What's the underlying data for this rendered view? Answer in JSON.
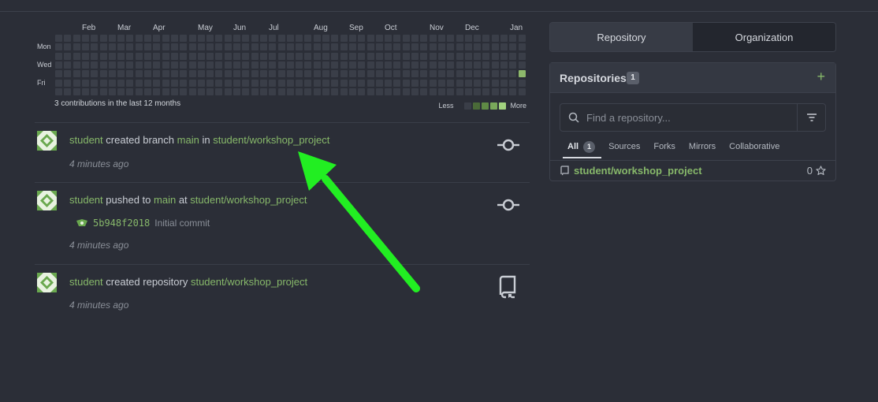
{
  "heatmap": {
    "months": [
      "Feb",
      "Mar",
      "Apr",
      "May",
      "Jun",
      "Jul",
      "Aug",
      "Sep",
      "Oct",
      "Nov",
      "Dec",
      "Jan"
    ],
    "days": [
      "Mon",
      "Wed",
      "Fri"
    ],
    "summary": "3 contributions in the last 12 months",
    "legend_less": "Less",
    "legend_more": "More",
    "level_colors": [
      "#3a3e48",
      "#4a6a38",
      "#5f8a45",
      "#79a85a",
      "#a2d27f"
    ],
    "active_color": "#8db86b"
  },
  "feed": [
    {
      "actor": "student",
      "action_a": "created branch",
      "ref": "main",
      "prep": "in",
      "repo": "student/workshop_project",
      "time": "4 minutes ago",
      "icon": "git-commit-icon"
    },
    {
      "actor": "student",
      "action_a": "pushed to",
      "ref": "main",
      "prep": "at",
      "repo": "student/workshop_project",
      "commit_sha": "5b948f2018",
      "commit_message": "Initial commit",
      "time": "4 minutes ago",
      "icon": "git-commit-icon"
    },
    {
      "actor": "student",
      "action_a": "created repository",
      "repo": "student/workshop_project",
      "time": "4 minutes ago",
      "icon": "repo-icon"
    }
  ],
  "panel": {
    "tabs": [
      "Repository",
      "Organization"
    ],
    "title": "Repositories",
    "count": "1",
    "search_placeholder": "Find a repository...",
    "subtabs": [
      "All",
      "Sources",
      "Forks",
      "Mirrors",
      "Collaborative"
    ],
    "all_count": "1",
    "repos": [
      {
        "name": "student/workshop_project",
        "stars": "0"
      }
    ]
  },
  "colors": {
    "link": "#87b86a",
    "annotation_arrow": "#22ee22"
  }
}
